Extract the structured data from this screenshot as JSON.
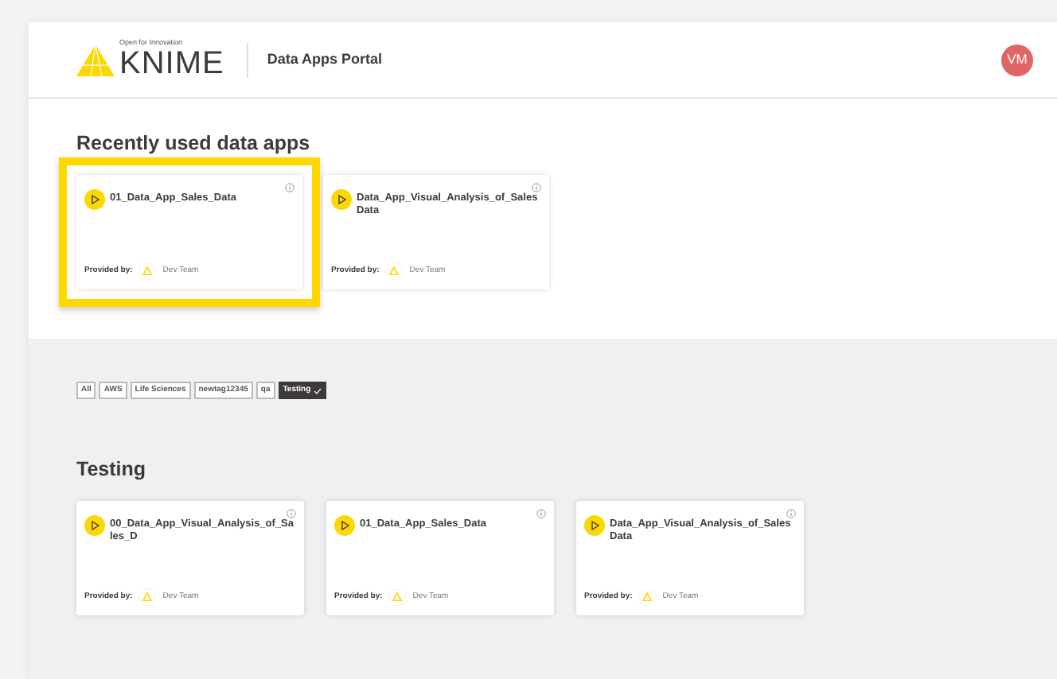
{
  "header": {
    "logo_tagline": "Open for Innovation",
    "logo_text": "KNIME",
    "title": "Data Apps Portal",
    "avatar": "VM"
  },
  "recent": {
    "heading": "Recently used data apps",
    "apps": [
      {
        "title": "01_Data_App_Sales_Data",
        "provided_label": "Provided by:",
        "provider": "Dev Team",
        "highlighted": true
      },
      {
        "title": "Data_App_Visual_Analysis_of_Sales Data",
        "provided_label": "Provided by:",
        "provider": "Dev Team",
        "highlighted": false
      }
    ]
  },
  "tags": [
    {
      "label": "All",
      "selected": false
    },
    {
      "label": "AWS",
      "selected": false
    },
    {
      "label": "Life Sciences",
      "selected": false
    },
    {
      "label": "newtag12345",
      "selected": false
    },
    {
      "label": "qa",
      "selected": false
    },
    {
      "label": "Testing",
      "selected": true
    }
  ],
  "section": {
    "heading": "Testing",
    "apps": [
      {
        "title": "00_Data_App_Visual_Analysis_of_Sales_D",
        "provided_label": "Provided by:",
        "provider": "Dev Team"
      },
      {
        "title": "01_Data_App_Sales_Data",
        "provided_label": "Provided by:",
        "provider": "Dev Team"
      },
      {
        "title": "Data_App_Visual_Analysis_of_Sales Data",
        "provided_label": "Provided by:",
        "provider": "Dev Team"
      }
    ]
  }
}
